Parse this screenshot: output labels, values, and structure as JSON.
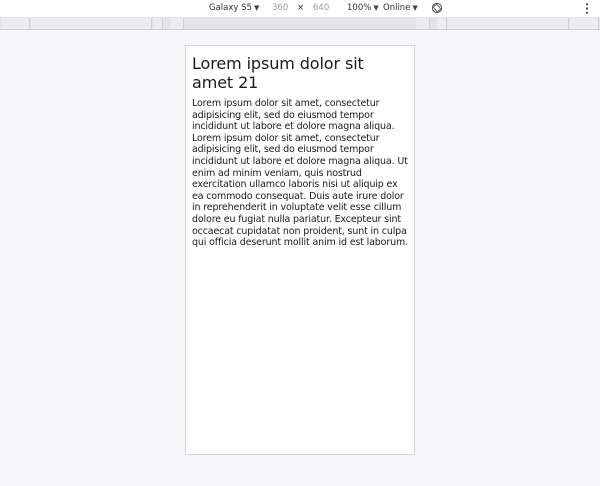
{
  "toolbar": {
    "device_name": "Galaxy S5",
    "width": "360",
    "separator": "×",
    "height": "640",
    "zoom": "100%",
    "network": "Online",
    "dropdown_glyph": "▼",
    "icons": [
      "rotate-icon",
      "more-options-icon"
    ]
  },
  "page": {
    "heading": "Lorem ipsum dolor sit amet 21",
    "body": "Lorem ipsum dolor sit amet, consectetur adipisicing elit, sed do eiusmod tempor incididunt ut labore et dolore magna aliqua. Lorem ipsum dolor sit amet, consectetur adipisicing elit, sed do eiusmod tempor incididunt ut labore et dolore magna aliqua. Ut enim ad minim veniam, quis nostrud exercitation ullamco laboris nisi ut aliquip ex ea commodo consequat. Duis aute irure dolor in reprehenderit in voluptate velit esse cillum dolore eu fugiat nulla pariatur. Excepteur sint occaecat cupidatat non proident, sunt in culpa qui officia deserunt mollit anim id est laborum."
  }
}
